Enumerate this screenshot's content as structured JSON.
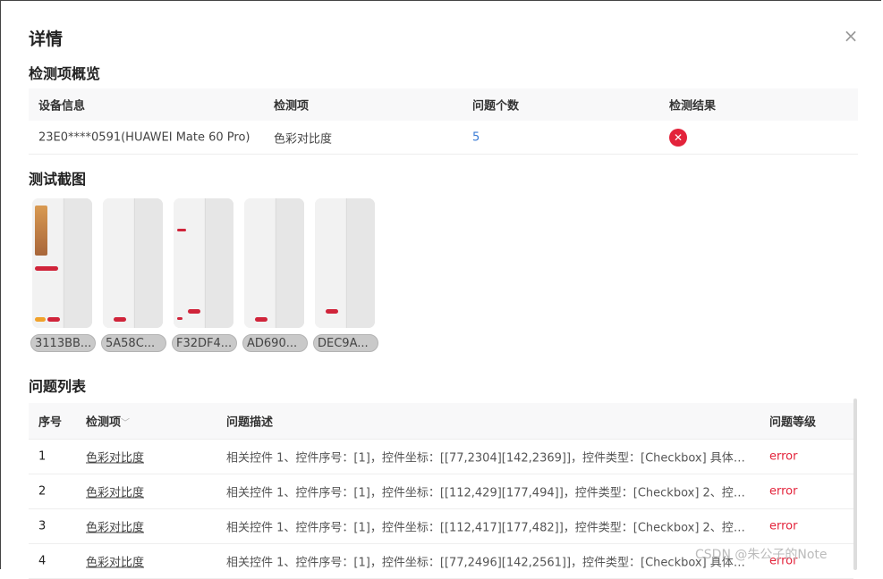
{
  "modal": {
    "title": "详情",
    "close_icon": "close-icon"
  },
  "overview": {
    "title": "检测项概览",
    "headers": [
      "设备信息",
      "检测项",
      "问题个数",
      "检测结果"
    ],
    "row": {
      "device": "23E0****0591(HUAWEI Mate 60 Pro)",
      "item": "色彩对比度",
      "count": "5",
      "result_icon": "error-circle-icon"
    }
  },
  "screenshots": {
    "title": "测试截图",
    "items": [
      {
        "label": "3113BB..."
      },
      {
        "label": "5A58C..."
      },
      {
        "label": "F32DF4..."
      },
      {
        "label": "AD690..."
      },
      {
        "label": "DEC9A..."
      }
    ]
  },
  "issues": {
    "title": "问题列表",
    "headers": {
      "index": "序号",
      "item": "检测项",
      "item_sort_icon": "chevron-down-icon",
      "desc": "问题描述",
      "level": "问题等级"
    },
    "rows": [
      {
        "index": "1",
        "item": "色彩对比度",
        "desc": "相关控件 1、控件序号：[1]，控件坐标：[[77,2304][142,2369]]，控件类型：[Checkbox] 具体问题 文...",
        "level": "error"
      },
      {
        "index": "2",
        "item": "色彩对比度",
        "desc": "相关控件 1、控件序号：[1]，控件坐标：[[112,429][177,494]]，控件类型：[Checkbox] 2、控件序号...",
        "level": "error"
      },
      {
        "index": "3",
        "item": "色彩对比度",
        "desc": "相关控件 1、控件序号：[1]，控件坐标：[[112,417][177,482]]，控件类型：[Checkbox] 2、控件序号...",
        "level": "error"
      },
      {
        "index": "4",
        "item": "色彩对比度",
        "desc": "相关控件 1、控件序号：[1]，控件坐标：[[77,2496][142,2561]]，控件类型：[Checkbox] 具体问题 文...",
        "level": "error"
      }
    ]
  },
  "watermark": "CSDN @朱公子的Note",
  "colors": {
    "error": "#e3233b",
    "link": "#3a7bd5"
  }
}
